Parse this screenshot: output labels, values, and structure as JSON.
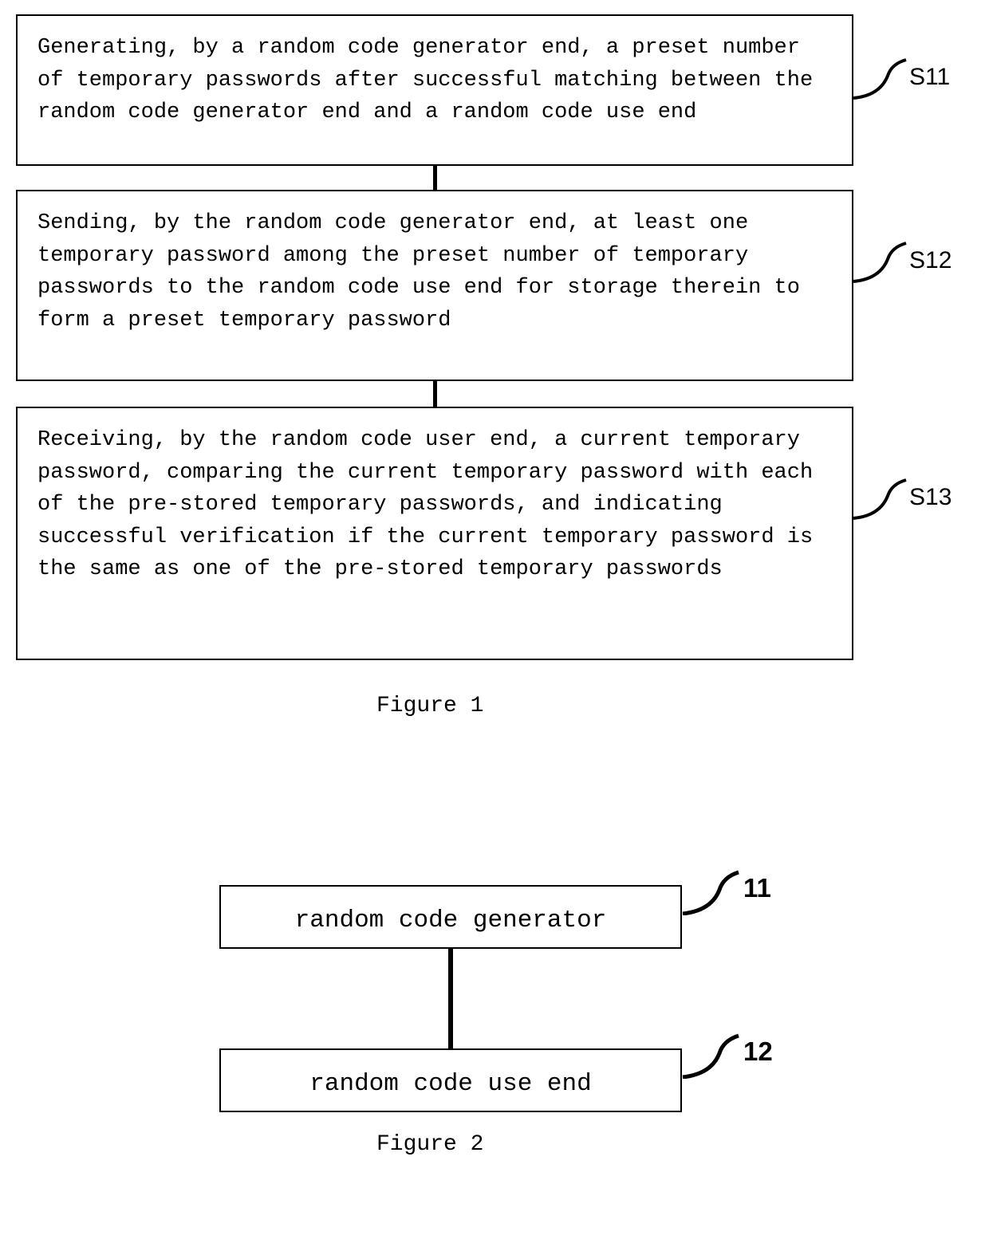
{
  "figure1": {
    "box1": {
      "text": "Generating, by a random code generator end, a preset number of temporary passwords after successful matching between the random code generator end and a random code use end",
      "label": "S11"
    },
    "box2": {
      "text": "Sending, by the random code generator end, at least one temporary password among the preset number of temporary passwords to the random code use end for storage therein to form a preset temporary password",
      "label": "S12"
    },
    "box3": {
      "text": "Receiving, by the random code user end, a current temporary password, comparing the current temporary password with each of the pre-stored temporary passwords, and indicating successful verification if the current temporary password is the same as one of the pre-stored temporary passwords",
      "label": "S13"
    },
    "caption": "Figure 1"
  },
  "figure2": {
    "box1": {
      "text": "random code generator",
      "label": "11"
    },
    "box2": {
      "text": "random code use end",
      "label": "12"
    },
    "caption": "Figure 2"
  }
}
